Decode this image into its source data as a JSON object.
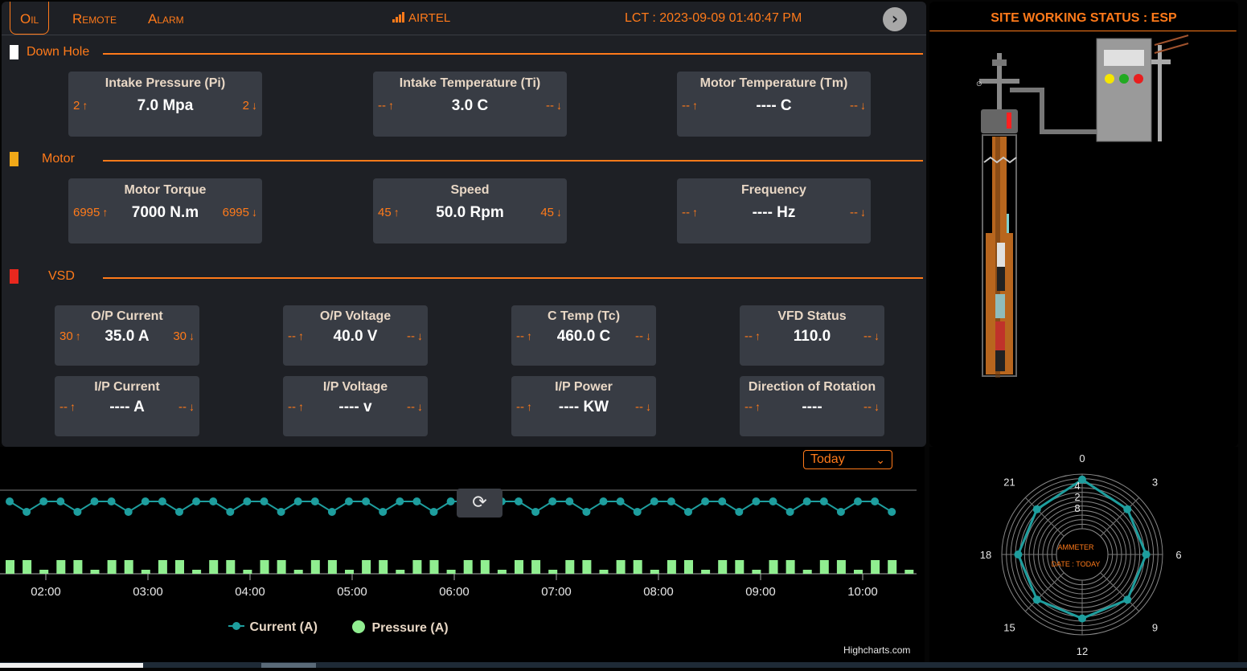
{
  "topbar": {
    "tabs": [
      "Oil",
      "Remote",
      "Alarm"
    ],
    "network": "AIRTEL",
    "lct": "LCT : 2023-09-09 01:40:47 PM"
  },
  "sections": {
    "downhole": "Down Hole",
    "motor": "Motor",
    "vsd": "VSD"
  },
  "downhole_cards": [
    {
      "title": "Intake Pressure (Pi)",
      "lo": "2",
      "value": "7.0 Mpa",
      "hi": "2"
    },
    {
      "title": "Intake Temperature (Ti)",
      "lo": "--",
      "value": "3.0 C",
      "hi": "--"
    },
    {
      "title": "Motor Temperature (Tm)",
      "lo": "--",
      "value": "---- C",
      "hi": "--"
    }
  ],
  "motor_cards": [
    {
      "title": "Motor Torque",
      "lo": "6995",
      "value": "7000 N.m",
      "hi": "6995"
    },
    {
      "title": "Speed",
      "lo": "45",
      "value": "50.0 Rpm",
      "hi": "45"
    },
    {
      "title": "Frequency",
      "lo": "--",
      "value": "---- Hz",
      "hi": "--"
    }
  ],
  "vsd_cards": [
    {
      "title": "O/P Current",
      "lo": "30",
      "value": "35.0 A",
      "hi": "30"
    },
    {
      "title": "O/P Voltage",
      "lo": "--",
      "value": "40.0 V",
      "hi": "--"
    },
    {
      "title": "C Temp (Tc)",
      "lo": "--",
      "value": "460.0 C",
      "hi": "--"
    },
    {
      "title": "VFD Status",
      "lo": "--",
      "value": "110.0",
      "hi": "--"
    },
    {
      "title": "I/P Current",
      "lo": "--",
      "value": "---- A",
      "hi": "--"
    },
    {
      "title": "I/P Voltage",
      "lo": "--",
      "value": "---- v",
      "hi": "--"
    },
    {
      "title": "I/P Power",
      "lo": "--",
      "value": "---- KW",
      "hi": "--"
    },
    {
      "title": "Direction of Rotation",
      "lo": "--",
      "value": "----",
      "hi": "--"
    }
  ],
  "site_status": "SITE WORKING STATUS : ESP",
  "colors": {
    "accent": "#ff7a1a",
    "downhole_marker": "#ffffff",
    "motor_marker": "#f0a818",
    "vsd_marker": "#e8281e",
    "current_series": "#1e9e9e",
    "pressure_series": "#90ee90"
  },
  "range_select": "Today",
  "chart_credit": "Highcharts.com",
  "chart_data": {
    "type": "line",
    "x_ticks": [
      "02:00",
      "03:00",
      "04:00",
      "05:00",
      "06:00",
      "07:00",
      "08:00",
      "09:00",
      "10:00"
    ],
    "series": [
      {
        "name": "Current (A)",
        "type": "line",
        "pattern": [
          1,
          0,
          1,
          1,
          0,
          1,
          1,
          0,
          1,
          1,
          0,
          1,
          1,
          0,
          1,
          1,
          0,
          1,
          1,
          0,
          1,
          1,
          0,
          1,
          1,
          0,
          1,
          1,
          0,
          1,
          1,
          0,
          1,
          1,
          0,
          1,
          1,
          0,
          1,
          1,
          0,
          1,
          1,
          0,
          1,
          1,
          0,
          1,
          1,
          0,
          1,
          1,
          0,
          1
        ]
      },
      {
        "name": "Pressure (A)",
        "type": "column",
        "pattern": [
          1,
          1,
          0,
          1,
          1,
          0,
          1,
          1,
          0,
          1,
          1,
          0,
          1,
          1,
          0,
          1,
          1,
          0,
          1,
          1,
          0,
          1,
          1,
          0,
          1,
          1,
          0,
          1,
          1,
          0,
          1,
          1,
          0,
          1,
          1,
          0,
          1,
          1,
          0,
          1,
          1,
          0,
          1,
          1,
          0,
          1,
          1,
          0,
          1,
          1,
          0,
          1,
          1,
          0
        ]
      }
    ]
  },
  "polar": {
    "center_label": "AMMETER",
    "date_label": "DATE : TODAY",
    "angle_labels": [
      "0",
      "3",
      "6",
      "9",
      "12",
      "15",
      "18",
      "21"
    ],
    "radial_labels": [
      "4",
      "2",
      "8"
    ],
    "values": [
      9,
      7,
      7,
      7,
      7,
      7,
      7,
      7
    ]
  }
}
